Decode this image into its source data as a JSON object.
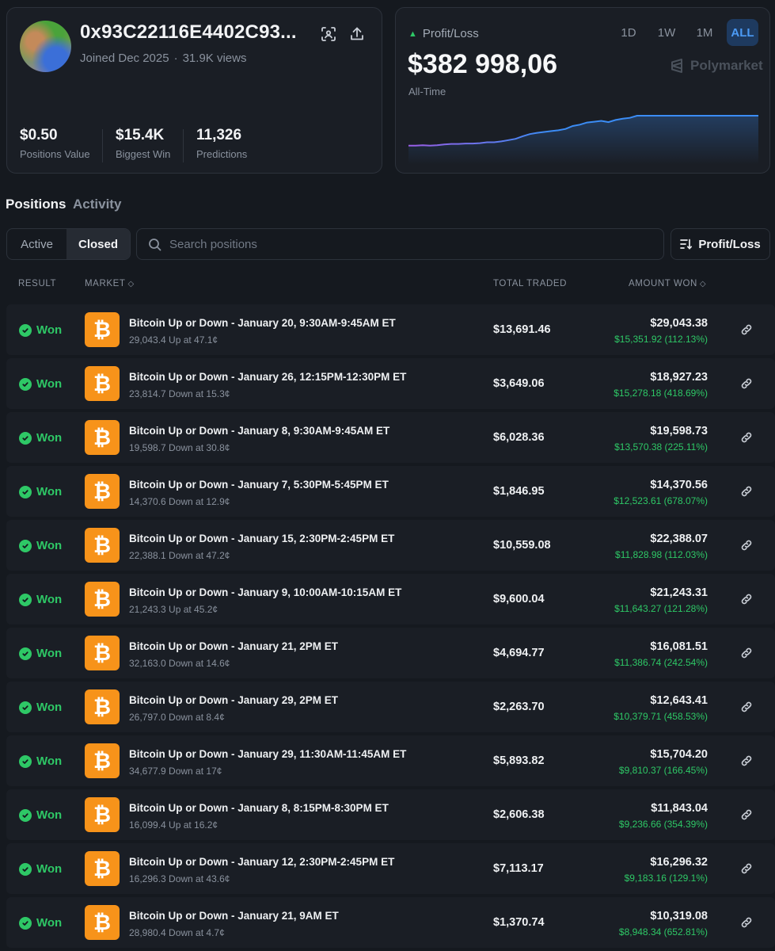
{
  "profile": {
    "address": "0x93C22116E4402C93...",
    "joined": "Joined Dec 2025",
    "separator": "·",
    "views": "31.9K views",
    "stats": [
      {
        "value": "$0.50",
        "label": "Positions Value"
      },
      {
        "value": "$15.4K",
        "label": "Biggest Win"
      },
      {
        "value": "11,326",
        "label": "Predictions"
      }
    ]
  },
  "pnl": {
    "label": "Profit/Loss",
    "value": "$382 998,06",
    "period": "All-Time",
    "ranges": [
      "1D",
      "1W",
      "1M",
      "ALL"
    ],
    "active_range": "ALL",
    "brand": "Polymarket",
    "line_gradient": [
      "#9b5de5",
      "#3b8cf5"
    ],
    "series": [
      0.3,
      0.3,
      0.31,
      0.3,
      0.31,
      0.33,
      0.34,
      0.34,
      0.35,
      0.35,
      0.36,
      0.38,
      0.38,
      0.4,
      0.43,
      0.46,
      0.52,
      0.57,
      0.6,
      0.62,
      0.64,
      0.66,
      0.69,
      0.76,
      0.79,
      0.84,
      0.86,
      0.88,
      0.85,
      0.9,
      0.93,
      0.95,
      1.0,
      1.0,
      1.0,
      1.0,
      1.0,
      1.0,
      1.0,
      1.0,
      1.0,
      1.0,
      1.0,
      1.0,
      1.0,
      1.0,
      1.0,
      1.0,
      1.0,
      1.0
    ]
  },
  "tabs": {
    "positions": "Positions",
    "activity": "Activity"
  },
  "filter": {
    "active": "Active",
    "closed": "Closed"
  },
  "search": {
    "placeholder": "Search positions"
  },
  "sort": {
    "label": "Profit/Loss"
  },
  "columns": {
    "result": "RESULT",
    "market": "MARKET",
    "total_traded": "TOTAL TRADED",
    "amount_won": "AMOUNT WON",
    "sort_glyph": "◇"
  },
  "rows": [
    {
      "result": "Won",
      "title": "Bitcoin Up or Down - January 20, 9:30AM-9:45AM ET",
      "sub": "29,043.4 Up at 47.1¢",
      "traded": "$13,691.46",
      "won": "$29,043.38",
      "pnl": "$15,351.92 (112.13%)"
    },
    {
      "result": "Won",
      "title": "Bitcoin Up or Down - January 26, 12:15PM-12:30PM ET",
      "sub": "23,814.7 Down at 15.3¢",
      "traded": "$3,649.06",
      "won": "$18,927.23",
      "pnl": "$15,278.18 (418.69%)"
    },
    {
      "result": "Won",
      "title": "Bitcoin Up or Down - January 8, 9:30AM-9:45AM ET",
      "sub": "19,598.7 Down at 30.8¢",
      "traded": "$6,028.36",
      "won": "$19,598.73",
      "pnl": "$13,570.38 (225.11%)"
    },
    {
      "result": "Won",
      "title": "Bitcoin Up or Down - January 7, 5:30PM-5:45PM ET",
      "sub": "14,370.6 Down at 12.9¢",
      "traded": "$1,846.95",
      "won": "$14,370.56",
      "pnl": "$12,523.61 (678.07%)"
    },
    {
      "result": "Won",
      "title": "Bitcoin Up or Down - January 15, 2:30PM-2:45PM ET",
      "sub": "22,388.1 Down at 47.2¢",
      "traded": "$10,559.08",
      "won": "$22,388.07",
      "pnl": "$11,828.98 (112.03%)"
    },
    {
      "result": "Won",
      "title": "Bitcoin Up or Down - January 9, 10:00AM-10:15AM ET",
      "sub": "21,243.3 Up at 45.2¢",
      "traded": "$9,600.04",
      "won": "$21,243.31",
      "pnl": "$11,643.27 (121.28%)"
    },
    {
      "result": "Won",
      "title": "Bitcoin Up or Down - January 21, 2PM ET",
      "sub": "32,163.0 Down at 14.6¢",
      "traded": "$4,694.77",
      "won": "$16,081.51",
      "pnl": "$11,386.74 (242.54%)"
    },
    {
      "result": "Won",
      "title": "Bitcoin Up or Down - January 29, 2PM ET",
      "sub": "26,797.0 Down at 8.4¢",
      "traded": "$2,263.70",
      "won": "$12,643.41",
      "pnl": "$10,379.71 (458.53%)"
    },
    {
      "result": "Won",
      "title": "Bitcoin Up or Down - January 29, 11:30AM-11:45AM ET",
      "sub": "34,677.9 Down at 17¢",
      "traded": "$5,893.82",
      "won": "$15,704.20",
      "pnl": "$9,810.37 (166.45%)"
    },
    {
      "result": "Won",
      "title": "Bitcoin Up or Down - January 8, 8:15PM-8:30PM ET",
      "sub": "16,099.4 Up at 16.2¢",
      "traded": "$2,606.38",
      "won": "$11,843.04",
      "pnl": "$9,236.66 (354.39%)"
    },
    {
      "result": "Won",
      "title": "Bitcoin Up or Down - January 12, 2:30PM-2:45PM ET",
      "sub": "16,296.3 Down at 43.6¢",
      "traded": "$7,113.17",
      "won": "$16,296.32",
      "pnl": "$9,183.16 (129.1%)"
    },
    {
      "result": "Won",
      "title": "Bitcoin Up or Down - January 21, 9AM ET",
      "sub": "28,980.4 Down at 4.7¢",
      "traded": "$1,370.74",
      "won": "$10,319.08",
      "pnl": "$8,948.34 (652.81%)"
    }
  ]
}
